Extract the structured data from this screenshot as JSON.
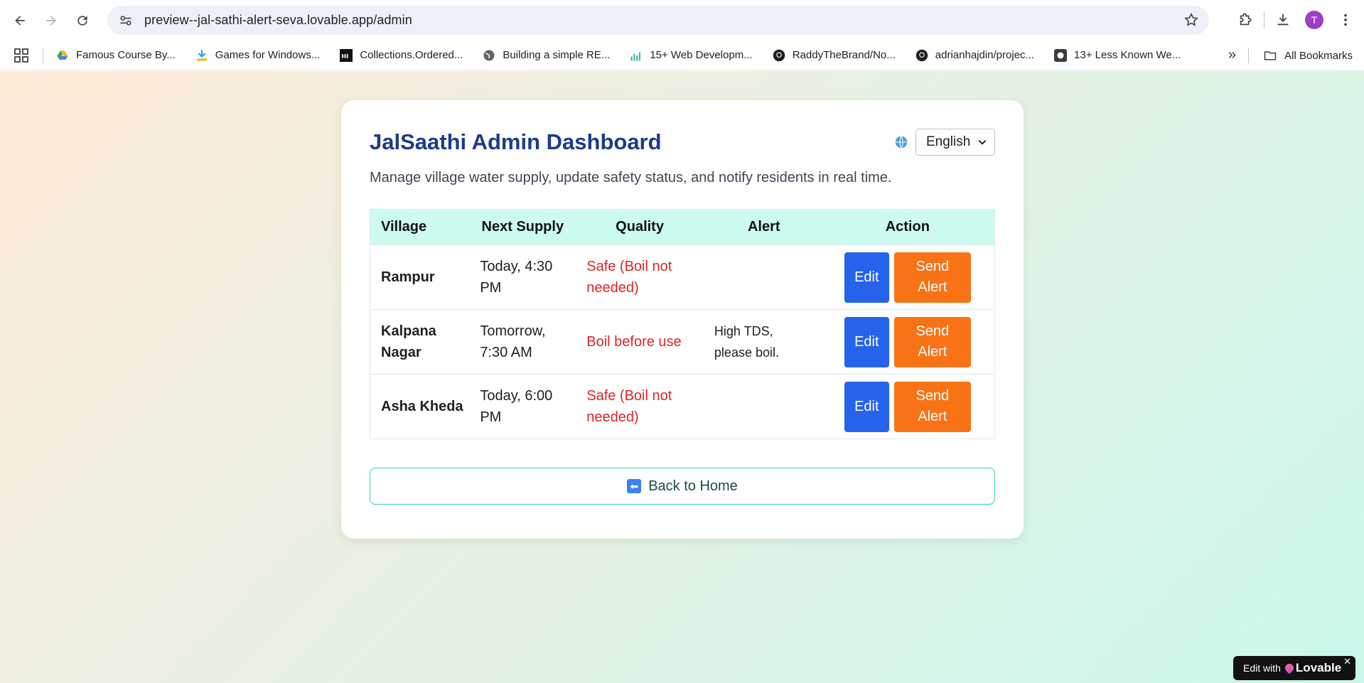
{
  "browser": {
    "url": "preview--jal-sathi-alert-seva.lovable.app/admin",
    "profile_initial": "T",
    "bookmarks": [
      {
        "label": "Famous Course By...",
        "icon": "drive-icon"
      },
      {
        "label": "Games for Windows...",
        "icon": "download-arrow-icon"
      },
      {
        "label": "Collections.Ordered...",
        "icon": "gfg-icon"
      },
      {
        "label": "Building a simple RE...",
        "icon": "globe-icon"
      },
      {
        "label": "15+ Web Developm...",
        "icon": "chart-icon"
      },
      {
        "label": "RaddyTheBrand/No...",
        "icon": "github-icon"
      },
      {
        "label": "adrianhajdin/projec...",
        "icon": "github-icon"
      },
      {
        "label": "13+ Less Known We...",
        "icon": "site-icon"
      }
    ],
    "all_bookmarks_label": "All Bookmarks"
  },
  "dashboard": {
    "title": "JalSaathi Admin Dashboard",
    "language": "English",
    "subtitle": "Manage village water supply, update safety status, and notify residents in real time.",
    "columns": [
      "Village",
      "Next Supply",
      "Quality",
      "Alert",
      "Action"
    ],
    "rows": [
      {
        "village": "Rampur",
        "next_supply": "Today, 4:30 PM",
        "quality": "Safe (Boil not needed)",
        "alert": ""
      },
      {
        "village": "Kalpana Nagar",
        "next_supply": "Tomorrow, 7:30 AM",
        "quality": "Boil before use",
        "alert": "High TDS, please boil."
      },
      {
        "village": "Asha Kheda",
        "next_supply": "Today, 6:00 PM",
        "quality": "Safe (Boil not needed)",
        "alert": ""
      }
    ],
    "edit_label": "Edit",
    "send_alert_label": "Send Alert",
    "back_label": "Back to Home"
  },
  "badge": {
    "prefix": "Edit with",
    "brand": "Lovable",
    "close": "✕"
  },
  "colors": {
    "title": "#1e3a8a",
    "header_bg": "#ccfbef",
    "quality": "#dc2626",
    "edit": "#2563eb",
    "send_alert": "#f97316",
    "back_border": "#2dd4bf"
  }
}
